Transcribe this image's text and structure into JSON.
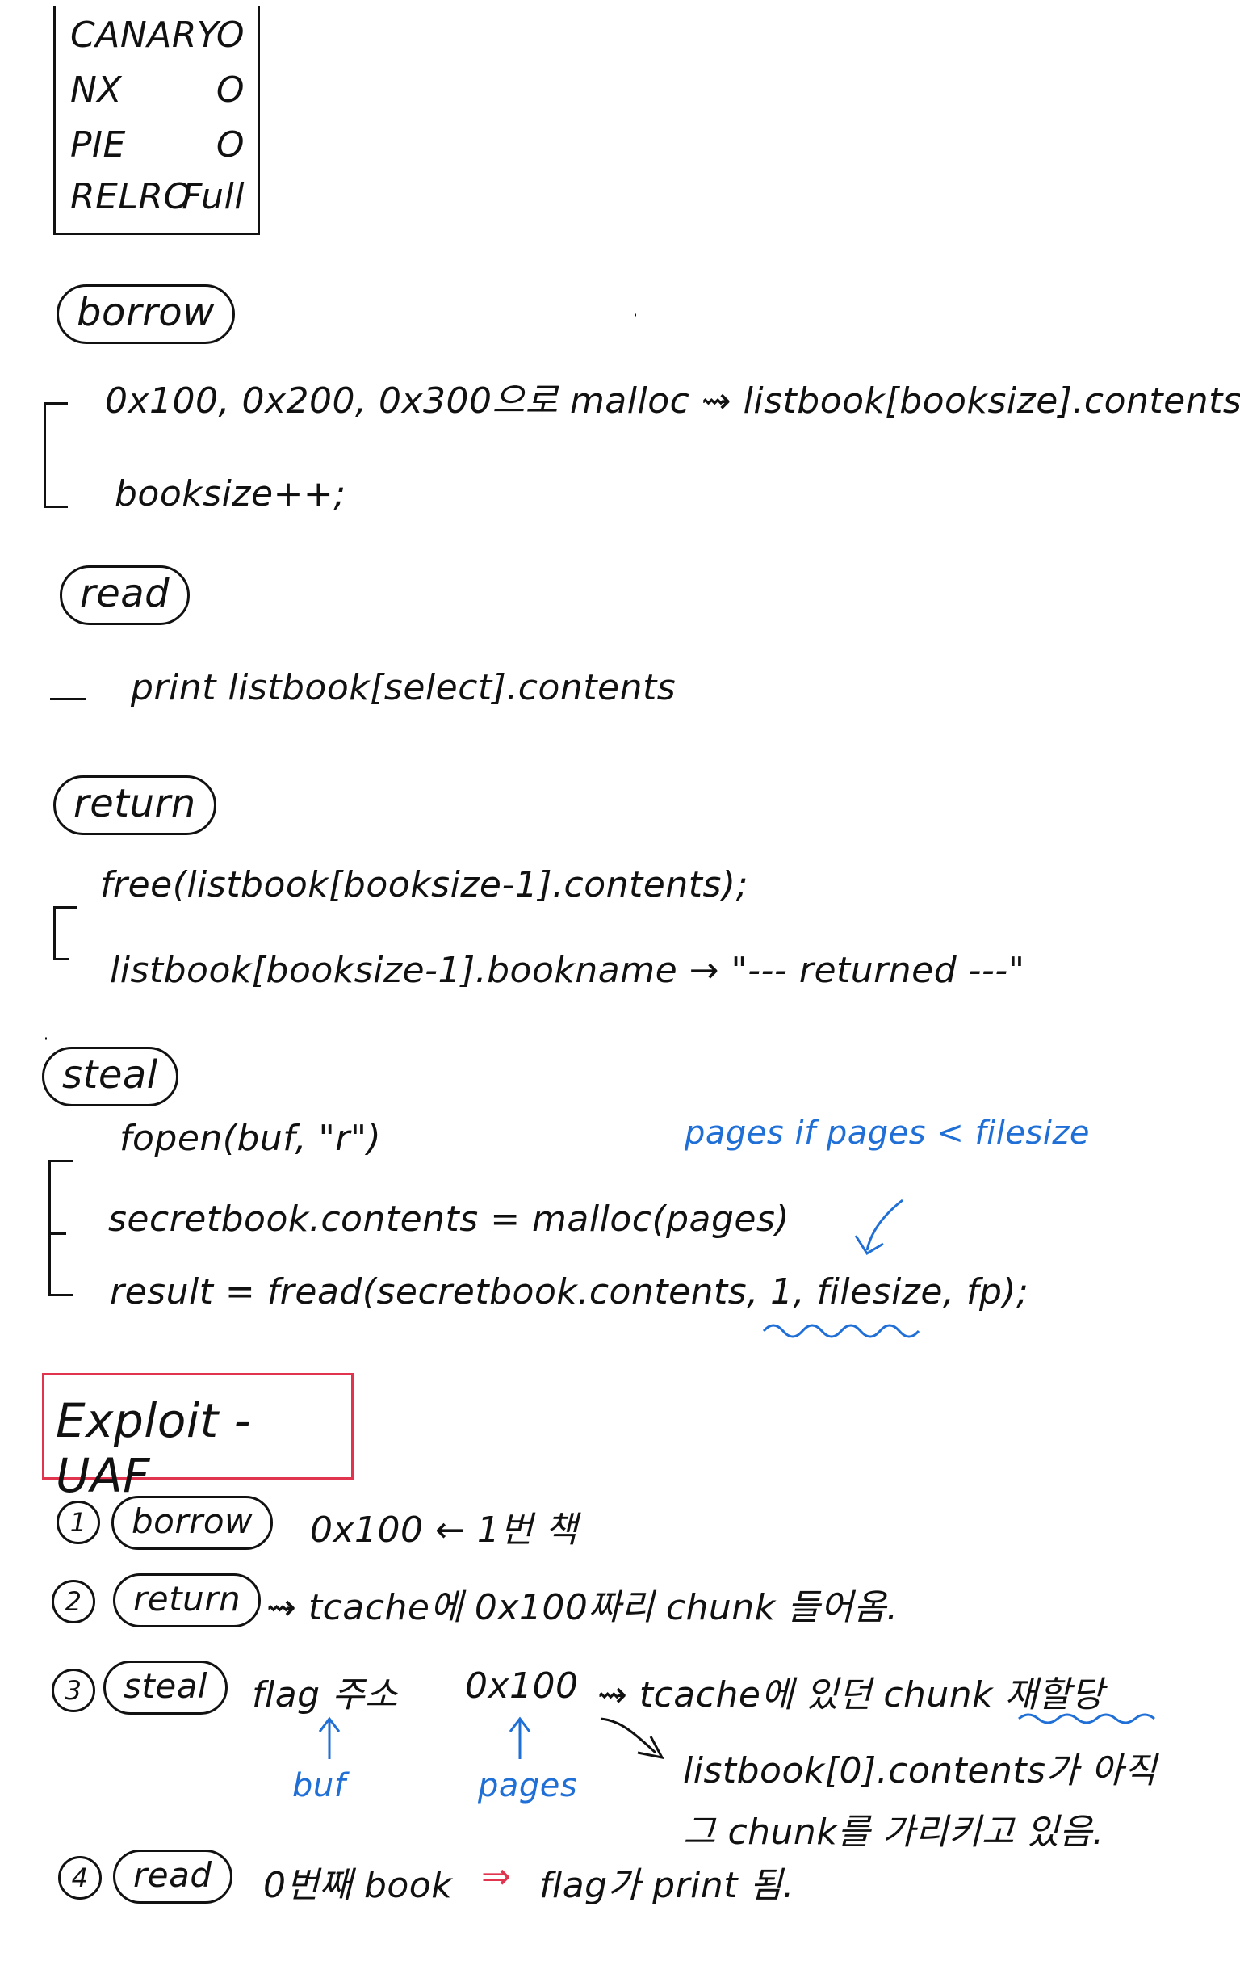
{
  "security": {
    "rows": [
      {
        "name": "CANARY",
        "value": "O"
      },
      {
        "name": "NX",
        "value": "O"
      },
      {
        "name": "PIE",
        "value": "O"
      },
      {
        "name": "RELRO",
        "value": "Full"
      }
    ]
  },
  "borrow": {
    "label": "borrow",
    "line1": "0x100, 0x200, 0x300으로 malloc ⇝ listbook[booksize].contents",
    "line2": "booksize++;"
  },
  "read": {
    "label": "read",
    "line1": "print listbook[select].contents"
  },
  "return": {
    "label": "return",
    "line1": "free(listbook[booksize-1].contents);",
    "line2": "listbook[booksize-1].bookname → \"--- returned ---\""
  },
  "steal": {
    "label": "steal",
    "line1": "fopen(buf, \"r\")",
    "line2": "secretbook.contents = malloc(pages)",
    "line3": "result = fread(secretbook.contents, 1, filesize, fp);",
    "note": "pages if pages < filesize"
  },
  "exploit": {
    "title": "Exploit - UAF",
    "steps": [
      {
        "num": "1",
        "label": "borrow",
        "text": "0x100 ← 1번 책"
      },
      {
        "num": "2",
        "label": "return",
        "text": "⇝ tcache에 0x100짜리 chunk 들어옴."
      },
      {
        "num": "3",
        "label": "steal",
        "text_a": "flag 주소",
        "text_b": "0x100",
        "text_c": "⇝ tcache에 있던 chunk 재할당",
        "note_buf": "buf",
        "note_pages": "pages",
        "sub1": "listbook[0].contents가 아직",
        "sub2": "그 chunk를 가리키고 있음."
      },
      {
        "num": "4",
        "label": "read",
        "text_a": "0번째 book",
        "text_b": "⇒",
        "text_c": "flag가 print 됨."
      }
    ]
  }
}
